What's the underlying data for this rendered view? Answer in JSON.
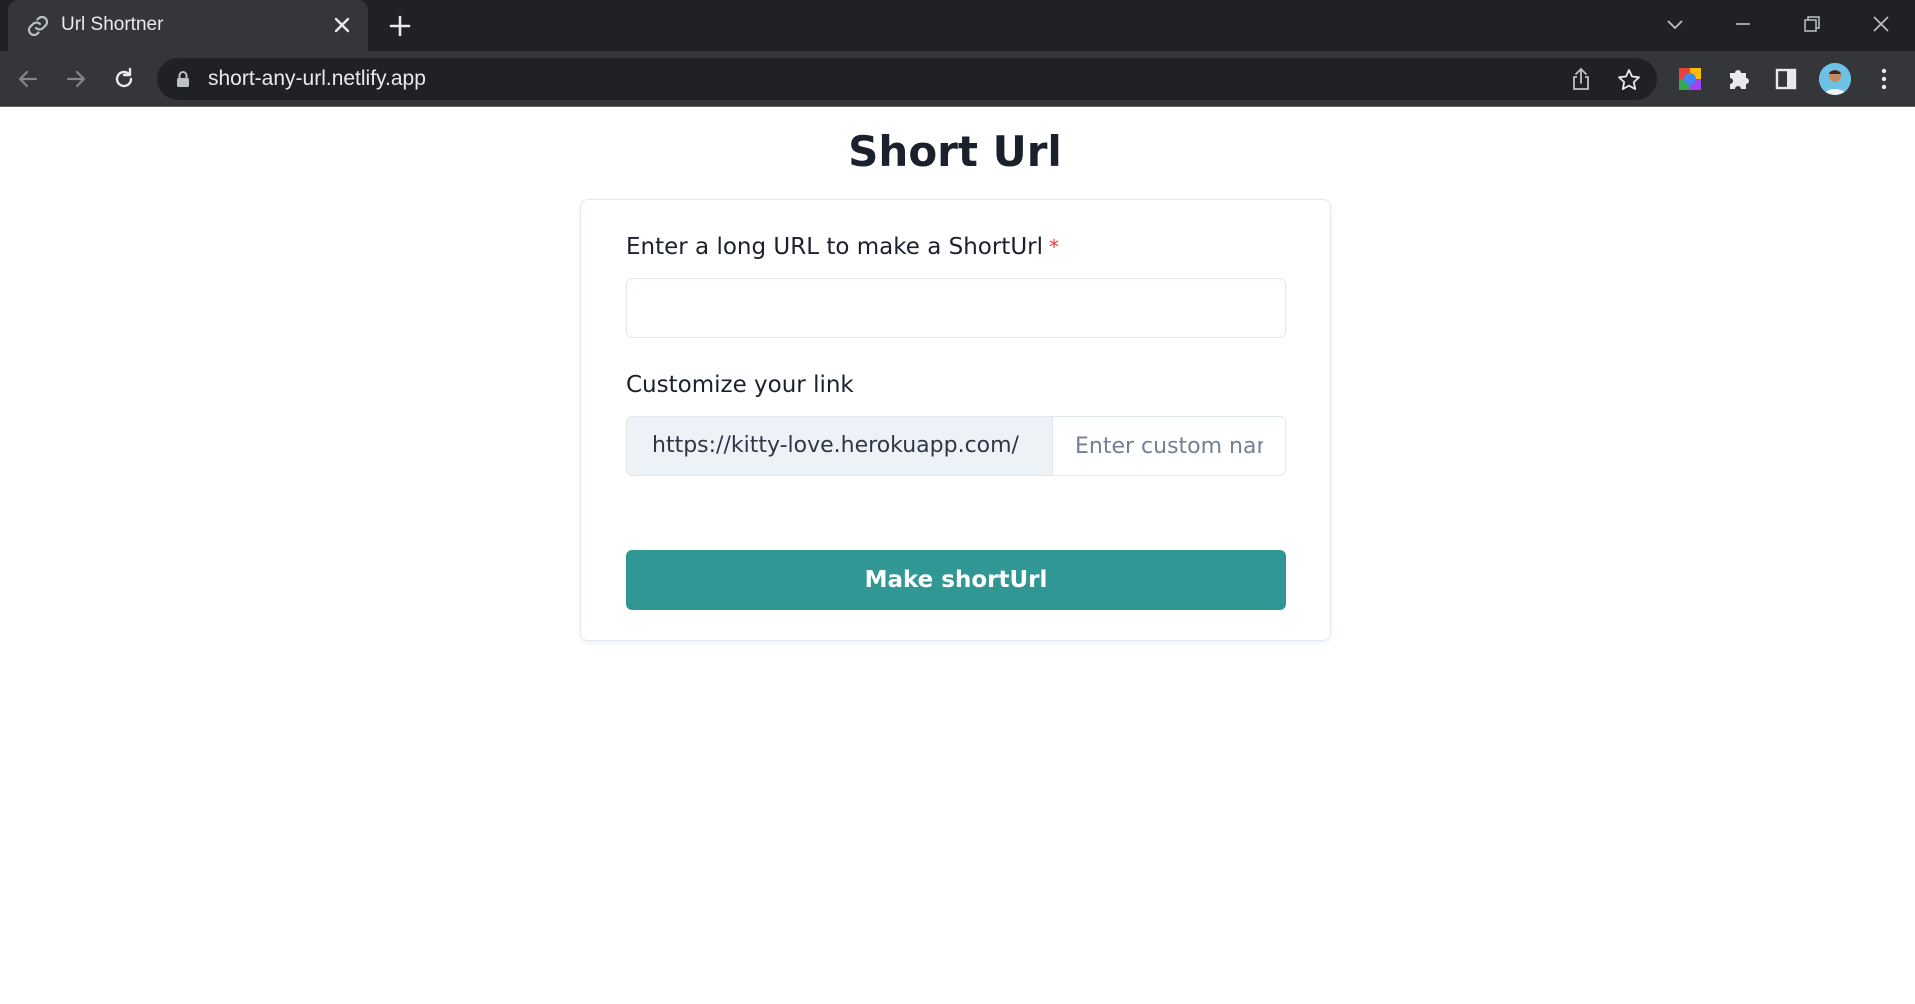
{
  "browser": {
    "tab": {
      "title": "Url Shortner",
      "favicon": "link-icon"
    },
    "address": "short-any-url.netlify.app",
    "icons": {
      "back": "arrow-left-icon",
      "forward": "arrow-right-icon",
      "reload": "reload-icon",
      "lock": "lock-icon",
      "share": "share-icon",
      "bookmark": "star-icon",
      "extension": "color-extension-icon",
      "extensions_menu": "puzzle-icon",
      "side_panel": "side-panel-icon",
      "profile": "avatar",
      "menu": "kebab-menu-icon"
    }
  },
  "page": {
    "title": "Short Url",
    "long_url": {
      "label": "Enter a long URL to make a ShortUrl",
      "required_mark": "*",
      "value": ""
    },
    "custom_link": {
      "label": "Customize your link",
      "prefix": "https://kitty-love.herokuapp.com/",
      "placeholder": "Enter custom name"
    },
    "submit_label": "Make shortUrl"
  },
  "colors": {
    "accent": "#319795",
    "required": "#e53e3e",
    "chrome_dark": "#202124",
    "chrome_toolbar": "#35363a"
  }
}
